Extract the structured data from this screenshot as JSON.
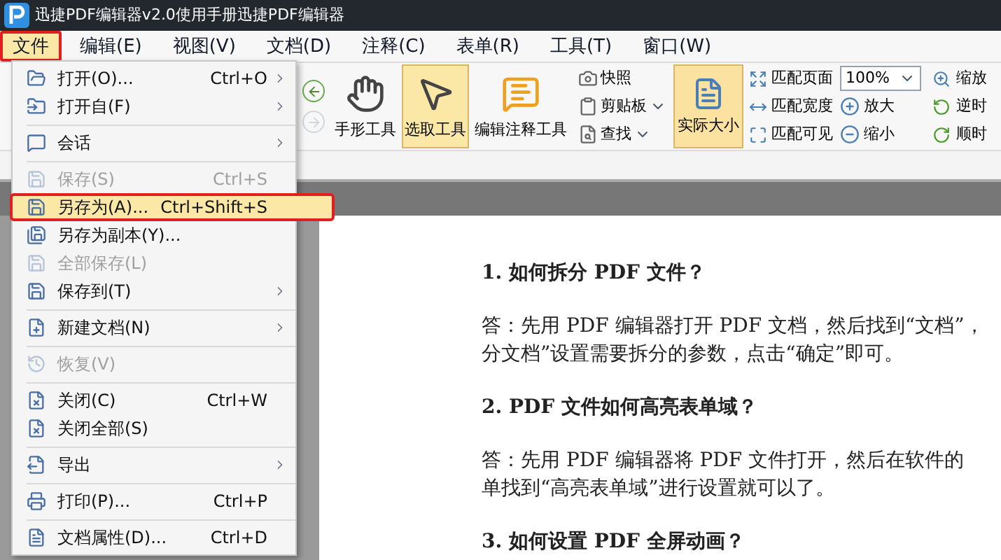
{
  "window": {
    "title": "迅捷PDF编辑器v2.0使用手册迅捷PDF编辑器"
  },
  "menu_bar": [
    {
      "label": "文件",
      "selected": true,
      "marked": true
    },
    {
      "label": "编辑(E)",
      "selected": false,
      "marked": false
    },
    {
      "label": "视图(V)",
      "selected": false,
      "marked": false
    },
    {
      "label": "文档(D)",
      "selected": false,
      "marked": false
    },
    {
      "label": "注释(C)",
      "selected": false,
      "marked": false
    },
    {
      "label": "表单(R)",
      "selected": false,
      "marked": false
    },
    {
      "label": "工具(T)",
      "selected": false,
      "marked": false
    },
    {
      "label": "窗口(W)",
      "selected": false,
      "marked": false
    }
  ],
  "toolbar": {
    "nav": [
      {
        "disabled": false
      },
      {
        "disabled": true
      }
    ],
    "tools": [
      {
        "label": "手形工具",
        "selected": false
      },
      {
        "label": "选取工具",
        "selected": true
      },
      {
        "label": "编辑注释工具",
        "selected": false
      }
    ],
    "edit_group": [
      {
        "label": "快照",
        "dropdown": false
      },
      {
        "label": "剪贴板",
        "dropdown": true
      },
      {
        "label": "查找",
        "dropdown": true
      }
    ],
    "actual_size": {
      "label": "实际大小",
      "selected": true
    },
    "fit_group": [
      "匹配页面",
      "匹配宽度",
      "匹配可见"
    ],
    "zoom": {
      "value": "100%"
    },
    "zoom_buttons": [
      "放大",
      "缩小"
    ],
    "view_group": [
      "缩放",
      "逆时",
      "顺时"
    ]
  },
  "file_menu": [
    {
      "kind": "item",
      "label": "打开(O)...",
      "shortcut": "Ctrl+O",
      "submenu": true,
      "disabled": false,
      "selected": false,
      "marked": false
    },
    {
      "kind": "item",
      "label": "打开自(F)",
      "submenu": true,
      "disabled": false,
      "selected": false,
      "marked": false
    },
    {
      "kind": "separator"
    },
    {
      "kind": "item",
      "label": "会话",
      "submenu": true,
      "disabled": false,
      "selected": false,
      "marked": false
    },
    {
      "kind": "separator"
    },
    {
      "kind": "item",
      "label": "保存(S)",
      "shortcut": "Ctrl+S",
      "submenu": false,
      "disabled": true,
      "selected": false,
      "marked": false
    },
    {
      "kind": "item",
      "label": "另存为(A)...",
      "shortcut": "Ctrl+Shift+S",
      "submenu": false,
      "disabled": false,
      "selected": true,
      "marked": true
    },
    {
      "kind": "item",
      "label": "另存为副本(Y)...",
      "submenu": false,
      "disabled": false,
      "selected": false,
      "marked": false
    },
    {
      "kind": "item",
      "label": "全部保存(L)",
      "submenu": false,
      "disabled": true,
      "selected": false,
      "marked": false
    },
    {
      "kind": "item",
      "label": "保存到(T)",
      "submenu": true,
      "disabled": false,
      "selected": false,
      "marked": false
    },
    {
      "kind": "separator"
    },
    {
      "kind": "item",
      "label": "新建文档(N)",
      "submenu": true,
      "disabled": false,
      "selected": false,
      "marked": false
    },
    {
      "kind": "separator"
    },
    {
      "kind": "item",
      "label": "恢复(V)",
      "submenu": false,
      "disabled": true,
      "selected": false,
      "marked": false
    },
    {
      "kind": "separator"
    },
    {
      "kind": "item",
      "label": "关闭(C)",
      "shortcut": "Ctrl+W",
      "submenu": false,
      "disabled": false,
      "selected": false,
      "marked": false
    },
    {
      "kind": "item",
      "label": "关闭全部(S)",
      "submenu": false,
      "disabled": false,
      "selected": false,
      "marked": false
    },
    {
      "kind": "separator"
    },
    {
      "kind": "item",
      "label": "导出",
      "submenu": true,
      "disabled": false,
      "selected": false,
      "marked": false
    },
    {
      "kind": "separator"
    },
    {
      "kind": "item",
      "label": "打印(P)...",
      "shortcut": "Ctrl+P",
      "submenu": false,
      "disabled": false,
      "selected": false,
      "marked": false
    },
    {
      "kind": "separator"
    },
    {
      "kind": "item",
      "label": "文档属性(D)...",
      "shortcut": "Ctrl+D",
      "submenu": false,
      "disabled": false,
      "selected": false,
      "marked": false
    }
  ],
  "document": {
    "blocks": [
      {
        "kind": "heading",
        "text": "1. 如何拆分 PDF 文件？"
      },
      {
        "kind": "paragraph",
        "lines": [
          "答：先用 PDF 编辑器打开 PDF 文档，然后找到“文档”，",
          "分文档”设置需要拆分的参数，点击“确定”即可。"
        ]
      },
      {
        "kind": "heading",
        "text": "2. PDF 文件如何高亮表单域？"
      },
      {
        "kind": "paragraph",
        "lines": [
          "答：先用 PDF 编辑器将 PDF 文件打开，然后在软件的",
          "单找到“高亮表单域”进行设置就可以了。"
        ]
      },
      {
        "kind": "heading",
        "text": "3. 如何设置 PDF 全屏动画？"
      }
    ]
  }
}
